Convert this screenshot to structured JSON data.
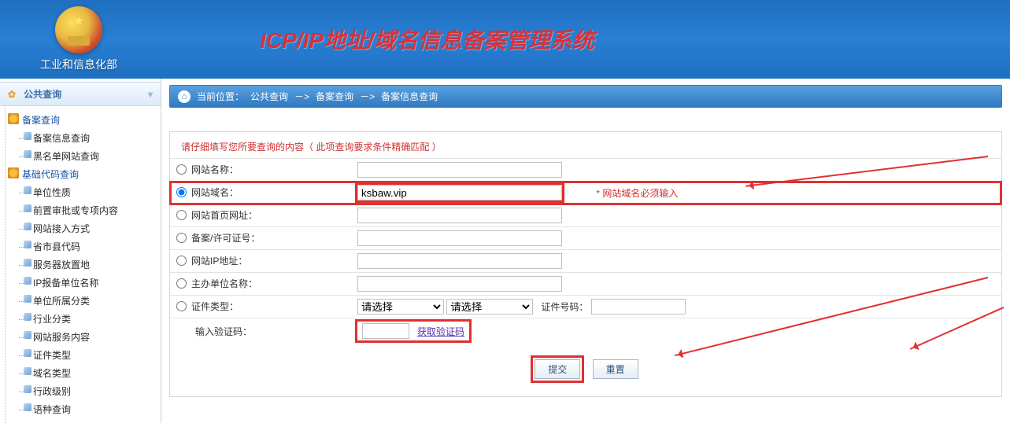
{
  "header": {
    "ministry": "工业和信息化部",
    "title": "ICP/IP地址/域名信息备案管理系统"
  },
  "sidebar": {
    "head": "公共查询",
    "groups": [
      {
        "label": "备案查询",
        "items": [
          "备案信息查询",
          "黑名单网站查询"
        ]
      },
      {
        "label": "基础代码查询",
        "items": [
          "单位性质",
          "前置审批或专项内容",
          "网站接入方式",
          "省市县代码",
          "服务器放置地",
          "IP报备单位名称",
          "单位所属分类",
          "行业分类",
          "网站服务内容",
          "证件类型",
          "域名类型",
          "行政级别",
          "语种查询"
        ]
      }
    ]
  },
  "crumb": {
    "prefix": "当前位置：",
    "a": "公共查询",
    "sep": "－>",
    "b": "备案查询",
    "c": "备案信息查询"
  },
  "form": {
    "hint": "请仔细填写您所要查询的内容（ 此项查询要求条件精确匹配 ）",
    "rows": {
      "site_name": "网站名称：",
      "domain": "网站域名：",
      "homepage": "网站首页网址：",
      "license": "备案/许可证号：",
      "ip": "网站IP地址：",
      "sponsor": "主办单位名称：",
      "cert_type": "证件类型：",
      "cert_no_label": "证件号码：",
      "captcha": "输入验证码："
    },
    "domain_value": "ksbaw.vip",
    "domain_required": "*  网站域名必须输入",
    "select_placeholder": "请选择",
    "captcha_link": "获取验证码",
    "submit": "提交",
    "reset": "重置"
  }
}
